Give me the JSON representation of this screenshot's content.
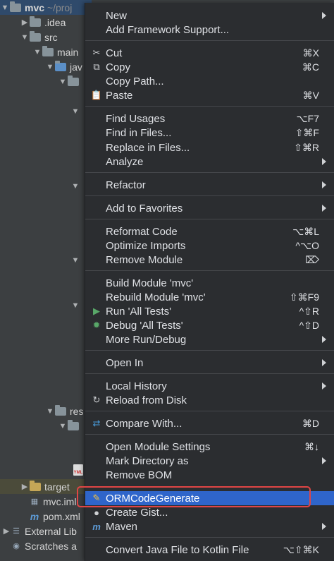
{
  "tree": {
    "root_name": "mvc",
    "root_path": "~/proj",
    "items": [
      "idea",
      "src",
      "main",
      "jav",
      "res",
      "target",
      "mvc.iml",
      "pom.xml",
      "External Lib",
      "Scratches a"
    ],
    "idea": ".idea",
    "src": "src",
    "main": "main",
    "jav": "jav",
    "res": "res",
    "target": "target",
    "iml": "mvc.iml",
    "pom": "pom.xml",
    "ext": "External Lib",
    "scratch": "Scratches a",
    "yml": "YML"
  },
  "menu": {
    "new": "New",
    "add_framework": "Add Framework Support...",
    "cut": {
      "label": "Cut",
      "shortcut": "⌘X"
    },
    "copy": {
      "label": "Copy",
      "shortcut": "⌘C"
    },
    "copy_path": "Copy Path...",
    "paste": {
      "label": "Paste",
      "shortcut": "⌘V"
    },
    "find_usages": {
      "label": "Find Usages",
      "shortcut": "⌥F7"
    },
    "find_in_files": {
      "label": "Find in Files...",
      "shortcut": "⇧⌘F"
    },
    "replace_in_files": {
      "label": "Replace in Files...",
      "shortcut": "⇧⌘R"
    },
    "analyze": "Analyze",
    "refactor": "Refactor",
    "add_favorites": "Add to Favorites",
    "reformat": {
      "label": "Reformat Code",
      "shortcut": "⌥⌘L"
    },
    "optimize": {
      "label": "Optimize Imports",
      "shortcut": "^⌥O"
    },
    "remove_module": {
      "label": "Remove Module",
      "shortcut": "⌦"
    },
    "build_module": "Build Module 'mvc'",
    "rebuild_module": {
      "label": "Rebuild Module 'mvc'",
      "shortcut": "⇧⌘F9"
    },
    "run_tests": {
      "label": "Run 'All Tests'",
      "shortcut": "^⇧R"
    },
    "debug_tests": {
      "label": "Debug 'All Tests'",
      "shortcut": "^⇧D"
    },
    "more_run": "More Run/Debug",
    "open_in": "Open In",
    "local_history": "Local History",
    "reload": "Reload from Disk",
    "compare": {
      "label": "Compare With...",
      "shortcut": "⌘D"
    },
    "module_settings": {
      "label": "Open Module Settings",
      "shortcut": "⌘↓"
    },
    "mark_dir": "Mark Directory as",
    "remove_bom": "Remove BOM",
    "orm": "ORMCodeGenerate",
    "gist": "Create Gist...",
    "maven": "Maven",
    "convert": {
      "label": "Convert Java File to Kotlin File",
      "shortcut": "⌥⇧⌘K"
    }
  },
  "colors": {
    "highlight": "#2f65ca",
    "annotation": "#e04545",
    "run": "#59a869",
    "debug": "#59a869"
  }
}
